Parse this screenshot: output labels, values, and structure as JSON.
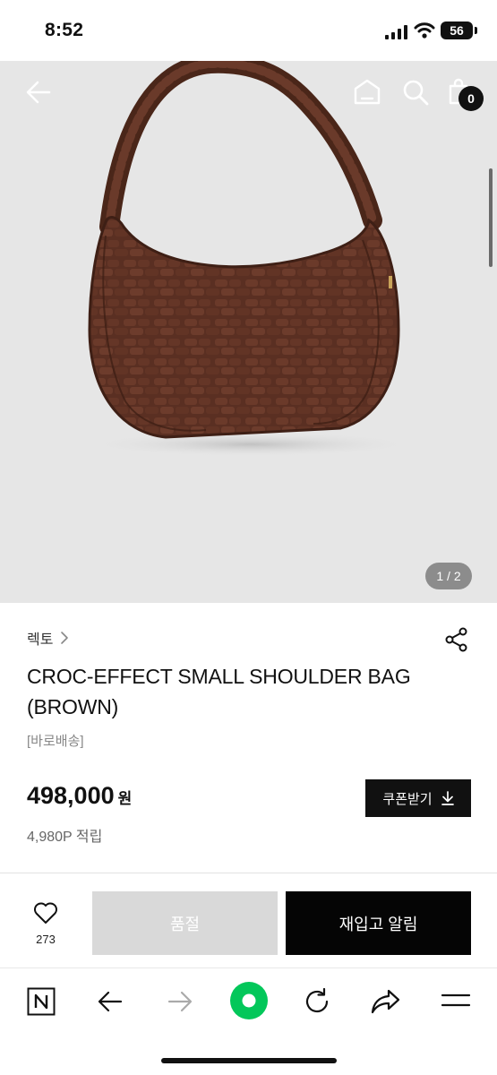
{
  "status_bar": {
    "time": "8:52",
    "battery": "56"
  },
  "gallery": {
    "pager": "1 / 2"
  },
  "header": {
    "cart_count": "0"
  },
  "product": {
    "brand": "렉토",
    "title": "CROC-EFFECT SMALL SHOULDER BAG (BROWN)",
    "shipping": "[바로배송]",
    "price": "498,000",
    "currency": "원",
    "points": "4,980P 적립",
    "coupon_label": "쿠폰받기"
  },
  "actions": {
    "like_count": "273",
    "soldout_label": "품절",
    "restock_label": "재입고 알림"
  },
  "colors": {
    "bag_brown": "#5a2f22",
    "hero_bg": "#e6e6e6",
    "accent": "#03c75a"
  },
  "icons": [
    "back-arrow-icon",
    "home-icon",
    "search-icon",
    "cart-icon",
    "share-icon",
    "heart-icon",
    "naver-n-icon",
    "back-icon",
    "forward-icon",
    "green-dot-icon",
    "reload-icon",
    "share-arrow-icon",
    "menu-icon"
  ]
}
